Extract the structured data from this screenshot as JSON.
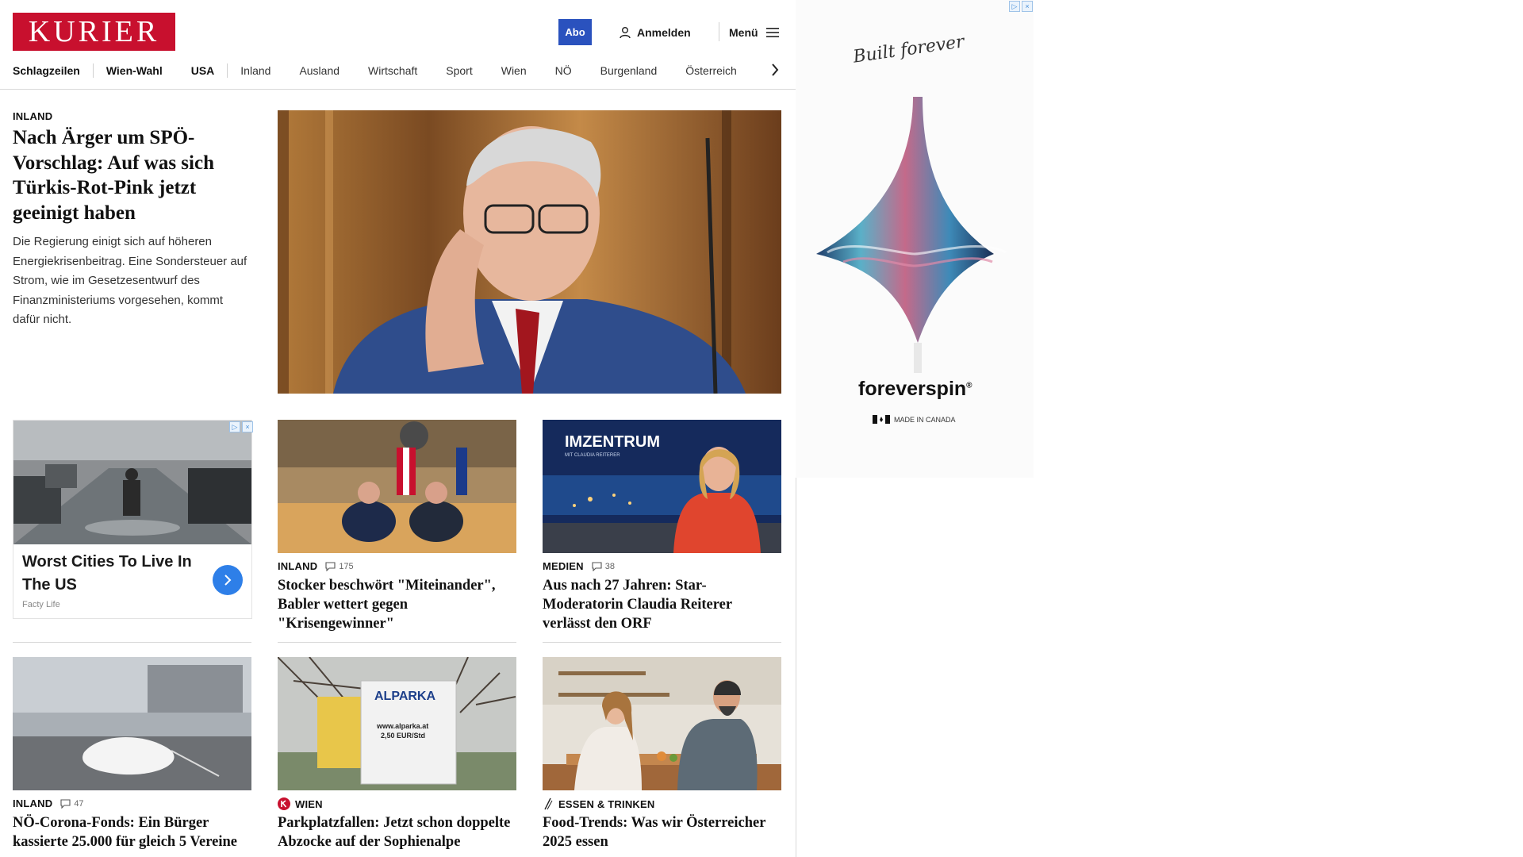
{
  "header": {
    "logo_text": "KURIER",
    "subscribe_label": "Abo",
    "login_label": "Anmelden",
    "menu_label": "Menü"
  },
  "nav": {
    "items": [
      "Schlagzeilen",
      "Wien-Wahl",
      "USA",
      "Inland",
      "Ausland",
      "Wirtschaft",
      "Sport",
      "Wien",
      "NÖ",
      "Burgenland",
      "Österreich"
    ]
  },
  "hero": {
    "kicker": "INLAND",
    "title": "Nach Ärger um SPÖ-Vorschlag: Auf was sich Türkis-Rot-Pink jetzt geeinigt haben",
    "teaser": "Die Regierung einigt sich auf höheren Energiekrisenbeitrag. Eine Sondersteuer auf Strom, wie im Gesetzesentwurf des Finanzministeriums vorgesehen, kommt dafür nicht."
  },
  "ad_card": {
    "title": "Worst Cities To Live In The US",
    "source": "Facty Life"
  },
  "cards": [
    {
      "kicker": "INLAND",
      "comments": "175",
      "title": "Stocker beschwört \"Miteinander\", Babler wettert gegen \"Krisengewinner\""
    },
    {
      "kicker": "MEDIEN",
      "comments": "38",
      "title": "Aus nach 27 Jahren: Star-Moderatorin Claudia Reiterer verlässt den ORF"
    },
    {
      "kicker": "INLAND",
      "comments": "47",
      "title": "NÖ-Corona-Fonds: Ein Bürger kassierte 25.000 für gleich 5 Vereine"
    },
    {
      "kicker": "WIEN",
      "title": "Parkplatzfallen: Jetzt schon doppelte Abzocke auf der Sophienalpe"
    },
    {
      "kicker": "ESSEN & TRINKEN",
      "title": "Food-Trends: Was wir Österreicher 2025 essen"
    }
  ],
  "images": {
    "zentrum_logo": "IMZENTRUM",
    "zentrum_sub": "MIT CLAUDIA REITERER",
    "parking_sign_brand": "ALPARKA",
    "parking_sign_url": "www.alparka.at",
    "parking_sign_price": "2,50 EUR/Std"
  },
  "right_ad": {
    "tagline": "Built forever",
    "brand": "foreverspin",
    "trademark": "®",
    "made_in": "MADE IN CANADA"
  },
  "icons": [
    "user-icon",
    "hamburger-icon",
    "chevron-right-icon",
    "comment-icon",
    "kurier-plus-icon",
    "food-icon",
    "adchoices-icon",
    "close-icon"
  ],
  "colors": {
    "brand_red": "#c8102e",
    "subscribe_blue": "#2a52be",
    "ad_button_blue": "#2e7fe8"
  }
}
